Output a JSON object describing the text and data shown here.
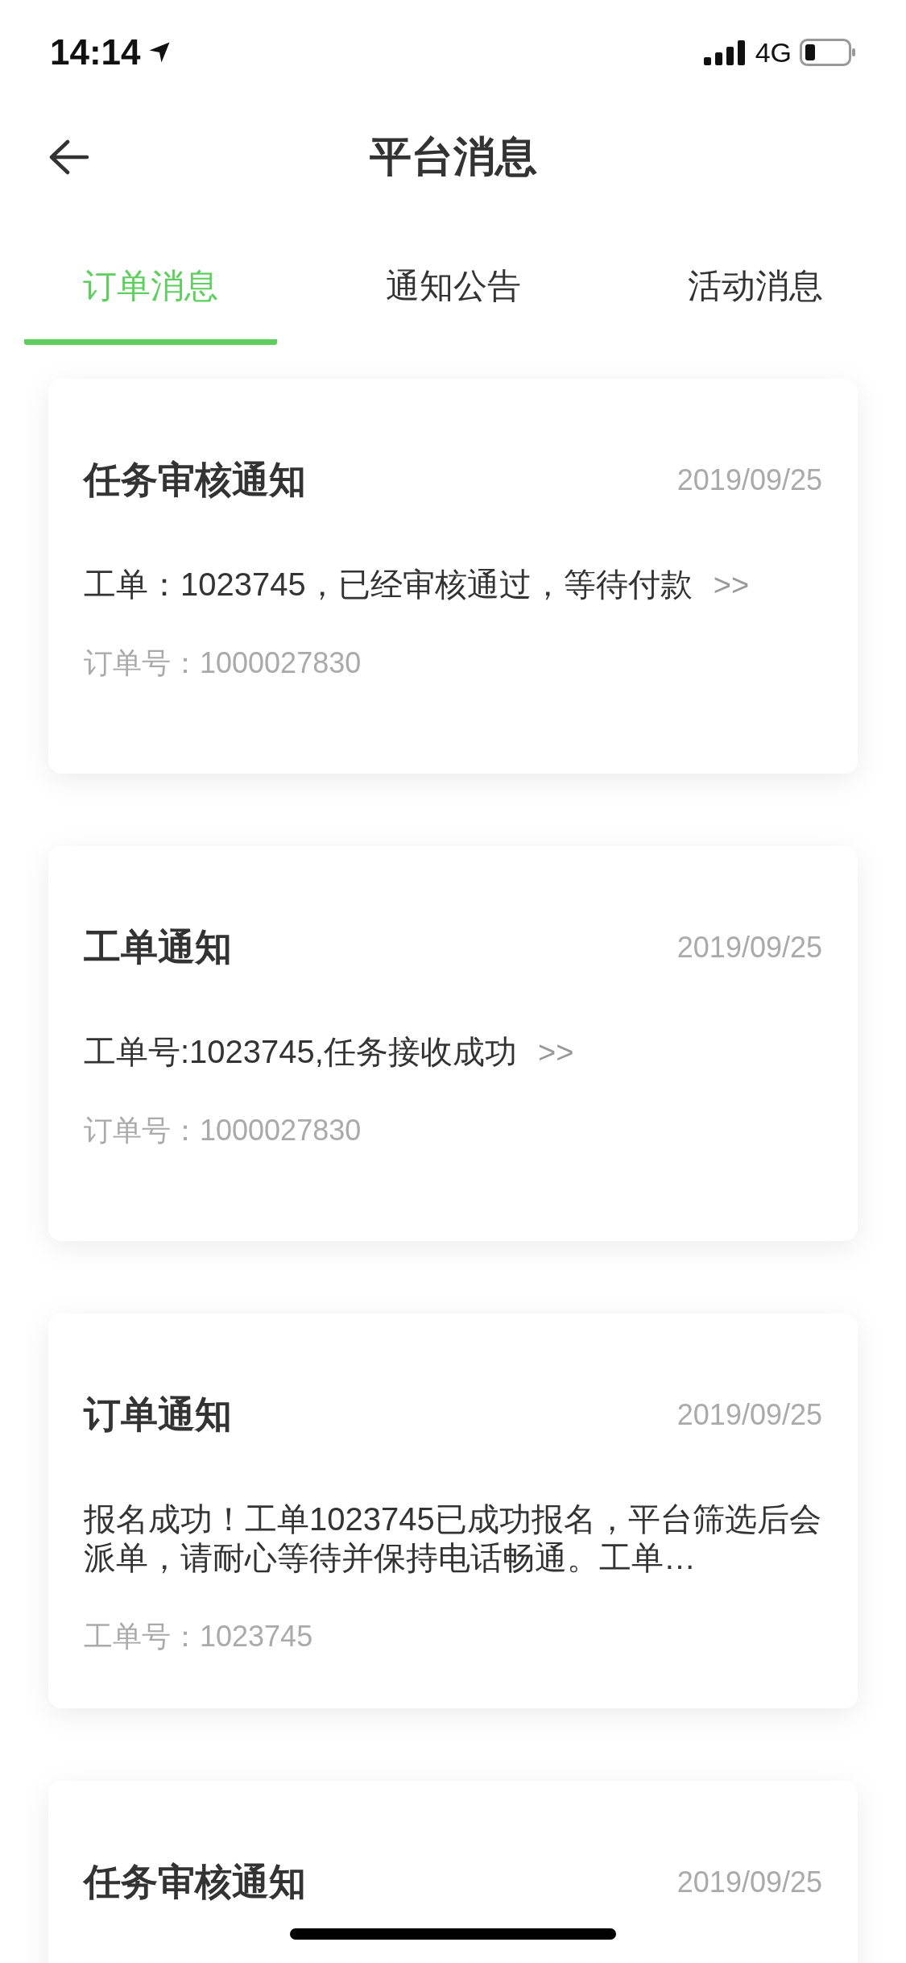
{
  "status_bar": {
    "time": "14:14",
    "network": "4G"
  },
  "nav": {
    "title": "平台消息"
  },
  "tabs": [
    {
      "label": "订单消息",
      "selected": true
    },
    {
      "label": "通知公告",
      "selected": false
    },
    {
      "label": "活动消息",
      "selected": false
    }
  ],
  "messages": [
    {
      "title": "任务审核通知",
      "date": "2019/09/25",
      "body": "工单：1023745，已经审核通过，等待付款",
      "more": ">>",
      "ref": "订单号：1000027830"
    },
    {
      "title": "工单通知",
      "date": "2019/09/25",
      "body": "工单号:1023745,任务接收成功",
      "more": ">>",
      "ref": "订单号：1000027830"
    },
    {
      "title": "订单通知",
      "date": "2019/09/25",
      "body": "报名成功！工单1023745已成功报名，平台筛选后会派单，请耐心等待并保持电话畅通。工单…",
      "ref": "工单号：1023745"
    },
    {
      "title": "任务审核通知",
      "date": "2019/09/25"
    }
  ]
}
